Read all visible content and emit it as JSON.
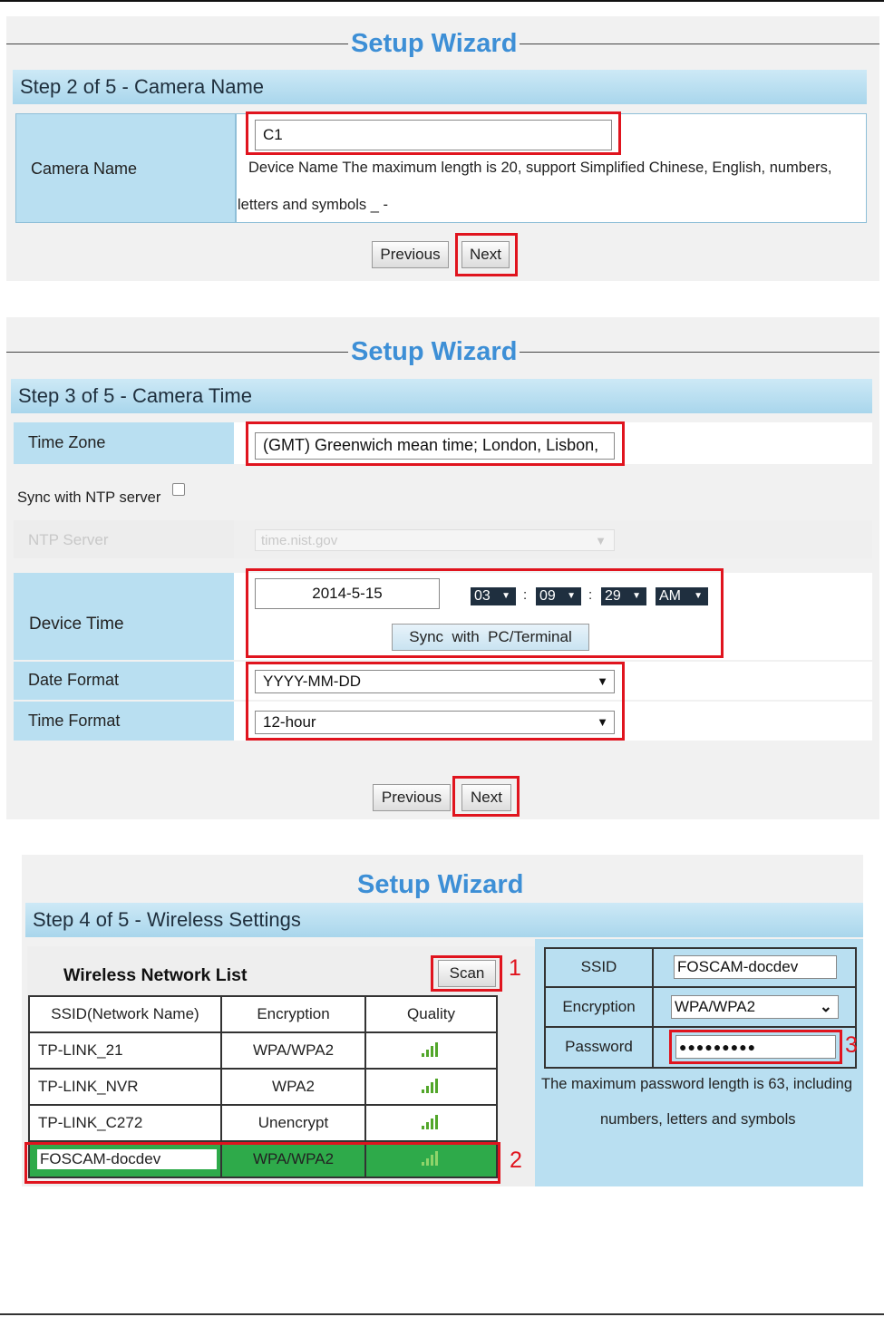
{
  "colors": {
    "title": "#3d8fd6",
    "highlight": "#e0141e",
    "label_bg": "#b9dff1",
    "selected_row": "#2eaa4a"
  },
  "wizard_title": "Setup Wizard",
  "step2": {
    "header": "Step 2 of 5 - Camera Name",
    "camera_name_label": "Camera Name",
    "camera_name_value": "C1",
    "note_line1": "Device Name The maximum length is 20, support Simplified Chinese, English, numbers,",
    "note_line2": "letters and symbols _ -",
    "previous": "Previous",
    "next": "Next"
  },
  "step3": {
    "header": "Step 3 of 5 - Camera Time",
    "time_zone_label": "Time Zone",
    "time_zone_value": "(GMT) Greenwich mean time; London, Lisbon,",
    "sync_ntp_label": "Sync with NTP server",
    "ntp_server_label": "NTP Server",
    "ntp_server_value": "time.nist.gov",
    "device_time_label": "Device Time",
    "date_value": "2014-5-15",
    "hour": "03",
    "minute": "09",
    "second": "29",
    "ampm": "AM",
    "sync_pc_button": "Sync  with  PC/Terminal",
    "date_format_label": "Date Format",
    "date_format_value": "YYYY-MM-DD",
    "time_format_label": "Time Format",
    "time_format_value": "12-hour",
    "previous": "Previous",
    "next": "Next"
  },
  "step4": {
    "header": "Step 4 of 5 - Wireless Settings",
    "list_title": "Wireless Network List",
    "scan": "Scan",
    "columns": [
      "SSID(Network Name)",
      "Encryption",
      "Quality"
    ],
    "networks": [
      {
        "ssid": "TP-LINK_21",
        "encryption": "WPA/WPA2"
      },
      {
        "ssid": "TP-LINK_NVR",
        "encryption": "WPA2"
      },
      {
        "ssid": "TP-LINK_C272",
        "encryption": "Unencrypt"
      },
      {
        "ssid": "FOSCAM-docdev",
        "encryption": "WPA/WPA2"
      }
    ],
    "ssid_label": "SSID",
    "ssid_value": "FOSCAM-docdev",
    "encryption_label": "Encryption",
    "encryption_value": "WPA/WPA2",
    "password_label": "Password",
    "password_value": "●●●●●●●●●",
    "note_line1": "The maximum password length is 63, including",
    "note_line2": "numbers, letters and symbols",
    "callouts": [
      "1",
      "2",
      "3"
    ]
  }
}
